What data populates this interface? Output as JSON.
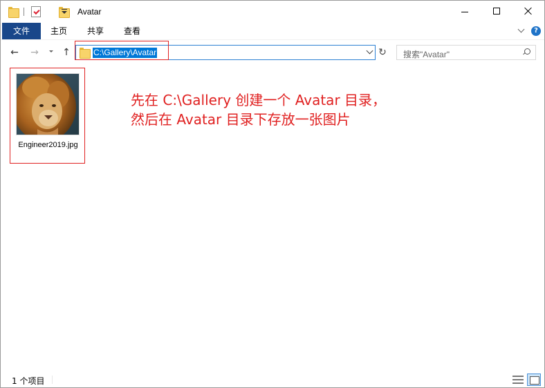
{
  "window": {
    "title": "Avatar"
  },
  "ribbon": {
    "tabs": [
      {
        "label": "文件",
        "active": true
      },
      {
        "label": "主页"
      },
      {
        "label": "共享"
      },
      {
        "label": "查看"
      }
    ],
    "help_label": "?"
  },
  "nav": {
    "back_glyph": "←",
    "forward_glyph": "→",
    "up_glyph": "↑",
    "address": "C:\\Gallery\\Avatar",
    "refresh_glyph": "↻",
    "search_placeholder": "搜索\"Avatar\""
  },
  "content": {
    "items": [
      {
        "name": "Engineer2019.jpg",
        "type": "image",
        "icon": "lion-thumbnail"
      }
    ],
    "annotation_lines": [
      "先在 C:\\Gallery 创建一个 Avatar 目录，",
      "然后在 Avatar 目录下存放一张图片"
    ]
  },
  "status": {
    "item_count": "1 个项目"
  },
  "colors": {
    "file_tab": "#19478a",
    "selection": "#0078d7",
    "annotation": "#e02020"
  }
}
